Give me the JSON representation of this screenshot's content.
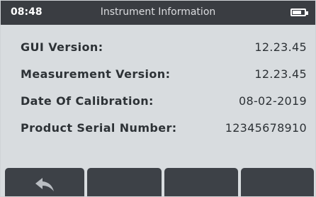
{
  "status_bar": {
    "time": "08:48",
    "title": "Instrument Information",
    "battery_icon": "battery-icon"
  },
  "info": {
    "rows": [
      {
        "label": "GUI Version:",
        "value": "12.23.45"
      },
      {
        "label": "Measurement Version:",
        "value": "12.23.45"
      },
      {
        "label": "Date Of Calibration:",
        "value": "08-02-2019"
      },
      {
        "label": "Product Serial Number:",
        "value": "12345678910"
      }
    ]
  },
  "softkeys": {
    "back_icon": "back-arrow-icon"
  },
  "colors": {
    "status_bar_bg": "#3a3d42",
    "screen_bg": "#d8dcdf",
    "softkey_bg": "#3d4147",
    "text": "#2d3236"
  }
}
